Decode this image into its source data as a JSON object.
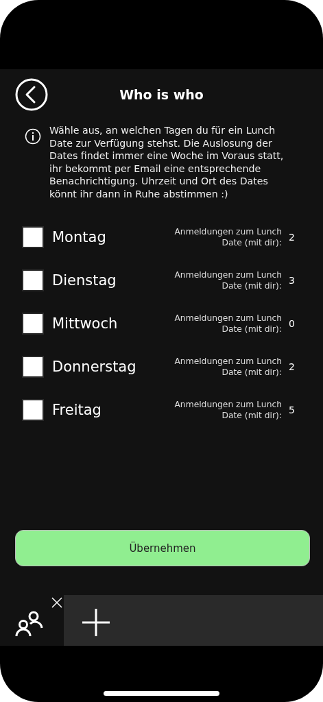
{
  "header": {
    "title": "Who is who"
  },
  "info": "Wähle aus, an welchen Tagen du für ein Lunch Date zur Verfügung stehst. Die Auslosung der Dates findet immer eine Woche im Voraus statt, ihr bekommt per Email eine entsprechende Benachrichtigung. Uhrzeit und Ort des Dates könnt ihr dann in Ruhe abstimmen :)",
  "days": [
    {
      "label": "Montag",
      "checked": false,
      "count_label": "Anmeldungen zum Lunch Date (mit dir):",
      "count": "2"
    },
    {
      "label": "Dienstag",
      "checked": false,
      "count_label": "Anmeldungen zum Lunch Date (mit dir):",
      "count": "3"
    },
    {
      "label": "Mittwoch",
      "checked": false,
      "count_label": "Anmeldungen zum Lunch Date (mit dir):",
      "count": "0"
    },
    {
      "label": "Donnerstag",
      "checked": false,
      "count_label": "Anmeldungen zum Lunch Date (mit dir):",
      "count": "2"
    },
    {
      "label": "Freitag",
      "checked": false,
      "count_label": "Anmeldungen zum Lunch Date (mit dir):",
      "count": "5"
    }
  ],
  "submit": "Übernehmen",
  "tabs": [
    {
      "selected": true
    }
  ]
}
